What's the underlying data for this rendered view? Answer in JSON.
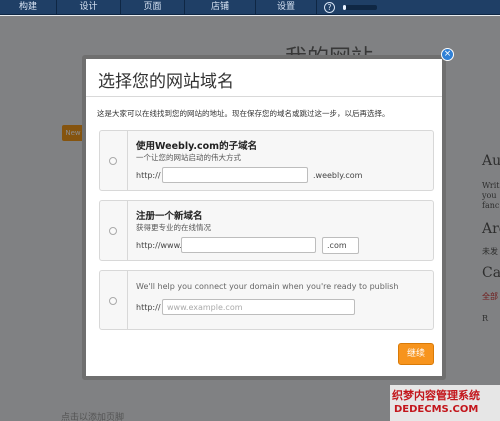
{
  "nav": {
    "items": [
      "构建",
      "设计",
      "页面",
      "店铺",
      "设置"
    ],
    "help_symbol": "?",
    "progress_fraction": 0.08
  },
  "background": {
    "page_title": "我的网站",
    "tab_label": "New",
    "side_text": [
      "Au",
      "Writ",
      "you",
      "fanc",
      "Arc",
      "未发",
      "Ca",
      "全部",
      "R"
    ],
    "footer_text": "点击以添加页脚"
  },
  "modal": {
    "title": "选择您的网站域名",
    "close_symbol": "×",
    "intro": "这是大家可以在线找到您的网站的地址。现在保存您的域名或跳过这一步，以后再选择。",
    "options": [
      {
        "title": "使用Weebly.com的子域名",
        "subtitle": "一个让您的网站启动的伟大方式",
        "prefix": "http://",
        "input_value": "",
        "suffix": ".weebly.com"
      },
      {
        "title": "注册一个新域名",
        "subtitle": "获得更专业的在线情况",
        "prefix": "http://www.",
        "input_value": "",
        "select_value": ".com"
      },
      {
        "help_text": "We'll help you connect your domain when you're ready to publish",
        "prefix": "http://",
        "input_placeholder": "www.example.com"
      }
    ],
    "continue_label": "继续"
  },
  "watermark": {
    "line1": "织梦内容管理系统",
    "line2": "DEDECMS.COM"
  },
  "colors": {
    "nav_bg": "#1f3f66",
    "accent_orange": "#f7941d",
    "close_blue": "#2f80d6"
  }
}
